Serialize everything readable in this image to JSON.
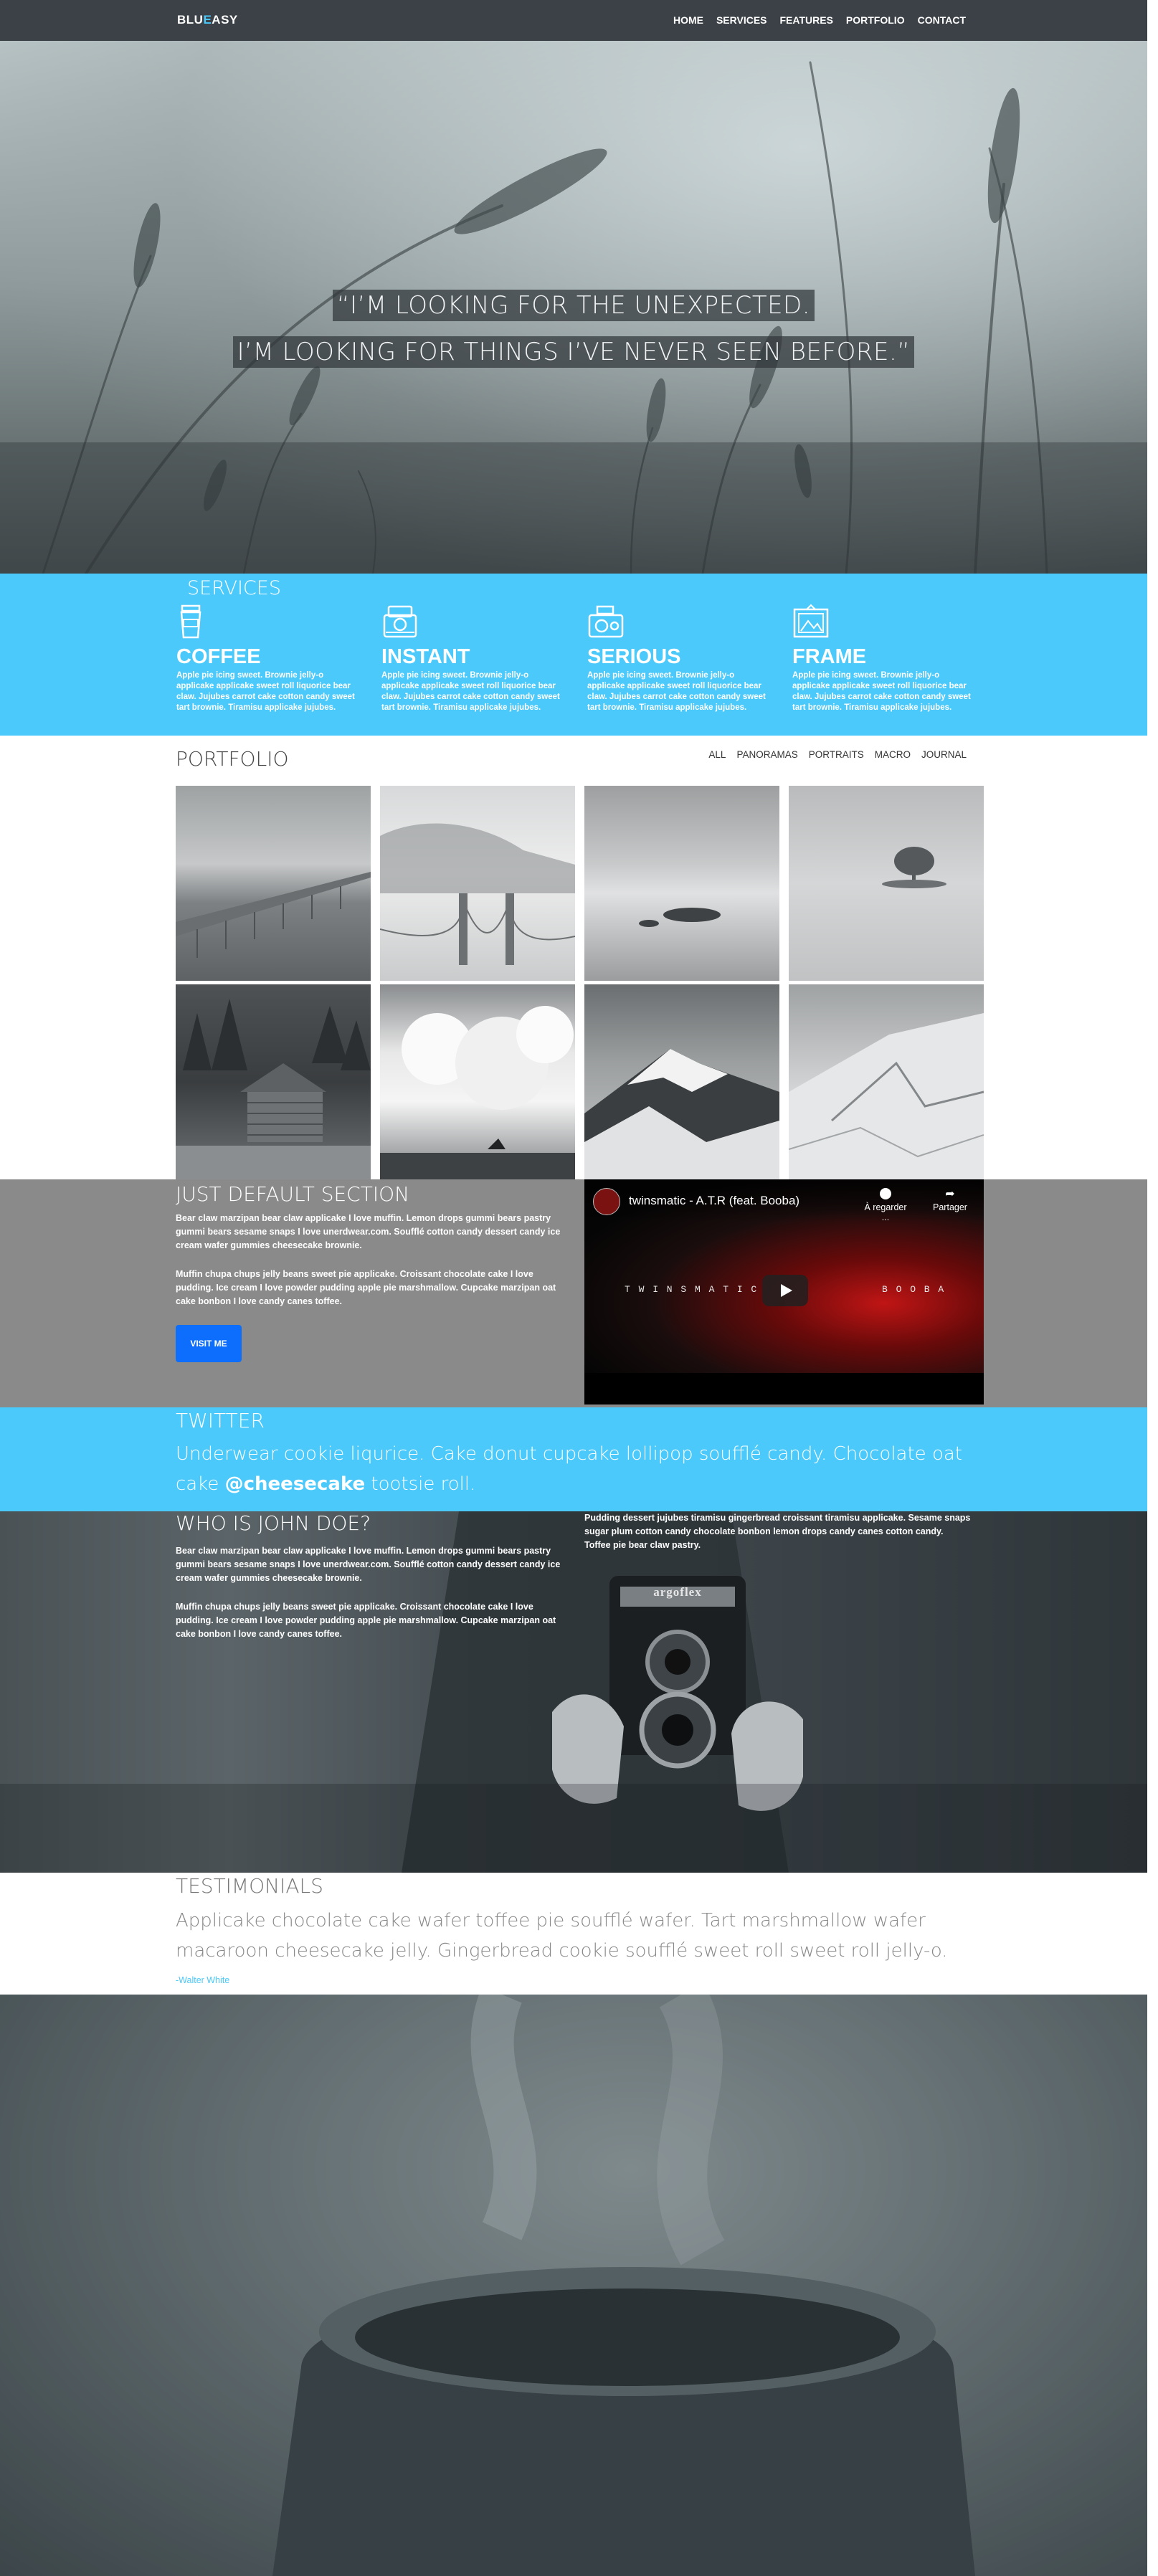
{
  "nav": {
    "brand_part1": "BLU",
    "brand_accent": "E",
    "brand_part2": "ASY",
    "links": [
      "HOME",
      "SERVICES",
      "FEATURES",
      "PORTFOLIO",
      "CONTACT"
    ]
  },
  "hero": {
    "line1": "“I’M LOOKING FOR THE UNEXPECTED.",
    "line2": "I’M LOOKING FOR THINGS I’VE NEVER SEEN BEFORE.”"
  },
  "services": {
    "title": "SERVICES",
    "items": [
      {
        "icon": "coffee-cup-icon",
        "title": "COFFEE",
        "text": "Apple pie icing sweet. Brownie jelly-o applicake applicake sweet roll liquorice bear claw. Jujubes carrot cake cotton candy sweet tart brownie. Tiramisu applicake jujubes."
      },
      {
        "icon": "instant-camera-icon",
        "title": "INSTANT",
        "text": "Apple pie icing sweet. Brownie jelly-o applicake applicake sweet roll liquorice bear claw. Jujubes carrot cake cotton candy sweet tart brownie. Tiramisu applicake jujubes."
      },
      {
        "icon": "rangefinder-camera-icon",
        "title": "SERIOUS",
        "text": "Apple pie icing sweet. Brownie jelly-o applicake applicake sweet roll liquorice bear claw. Jujubes carrot cake cotton candy sweet tart brownie. Tiramisu applicake jujubes."
      },
      {
        "icon": "picture-frame-icon",
        "title": "FRAME",
        "text": "Apple pie icing sweet. Brownie jelly-o applicake applicake sweet roll liquorice bear claw. Jujubes carrot cake cotton candy sweet tart brownie. Tiramisu applicake jujubes."
      }
    ]
  },
  "portfolio": {
    "title": "PORTFOLIO",
    "filters": [
      "ALL",
      "PANORAMAS",
      "PORTRAITS",
      "MACRO",
      "JOURNAL"
    ],
    "tiles": [
      "pier",
      "fog-bridge",
      "lake-island",
      "lone-tree",
      "log-cabin",
      "surfer-wave",
      "snowy-peak",
      "snowy-slope"
    ]
  },
  "default_section": {
    "title": "JUST DEFAULT SECTION",
    "para1": "Bear claw marzipan bear claw applicake I love muffin. Lemon drops gummi bears pastry gummi bears sesame snaps I love unerdwear.com. Soufflé cotton candy dessert candy ice cream wafer gummies cheesecake brownie.",
    "para2": "Muffin chupa chups jelly beans sweet pie applicake. Croissant chocolate cake I love pudding. Ice cream I love powder pudding apple pie marshmallow. Cupcake marzipan oat cake bonbon I love candy canes toffee.",
    "button": "VISIT ME",
    "video": {
      "title": "twinsmatic - A.T.R (feat. Booba)",
      "watch_later": "À regarder ...",
      "share": "Partager",
      "text_left": "T W I N S M A T I C",
      "text_right": "B O O B A"
    }
  },
  "twitter": {
    "title": "TWITTER",
    "text_before": "Underwear cookie liqurice. Cake donut cupcake lollipop soufflé candy. Chocolate oat cake",
    "handle": "@cheesecake",
    "text_after": "tootsie roll."
  },
  "who": {
    "title": "WHO IS JOHN DOE?",
    "para1": "Bear claw marzipan bear claw applicake I love muffin. Lemon drops gummi bears pastry gummi bears sesame snaps I love unerdwear.com. Soufflé cotton candy dessert candy ice cream wafer gummies cheesecake brownie.",
    "para2": "Muffin chupa chups jelly beans sweet pie applicake. Croissant chocolate cake I love pudding. Ice cream I love powder pudding apple pie marshmallow. Cupcake marzipan oat cake bonbon I love candy canes toffee.",
    "para3": "Pudding dessert jujubes tiramisu gingerbread croissant tiramisu applicake. Sesame snaps sugar plum cotton candy chocolate bonbon lemon drops candy canes cotton candy. Toffee pie bear claw pastry.",
    "camera_brand": "argoflex"
  },
  "testimonials": {
    "title": "TESTIMONIALS",
    "quote": "Applicake chocolate cake wafer toffee pie soufflé wafer. Tart marshmallow wafer macaroon cheesecake jelly. Gingerbread cookie soufflé sweet roll sweet roll jelly-o.",
    "author": "-Walter White"
  },
  "colors": {
    "nav_bg": "#3b4147",
    "accent": "#4bc9fb",
    "default_bg": "#8a8a8a",
    "button_bg": "#0d6efd"
  }
}
